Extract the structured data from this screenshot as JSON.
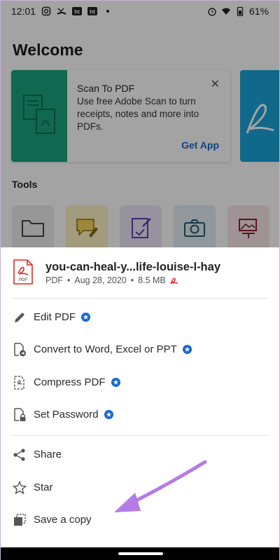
{
  "status_bar": {
    "time": "12:01",
    "battery": "61%",
    "left_icons": [
      "instagram-icon",
      "missed-call-icon",
      "ht-icon",
      "ht-icon",
      "dot-icon"
    ],
    "right_icons": [
      "alarm-icon",
      "wifi-icon",
      "battery-icon"
    ]
  },
  "home": {
    "welcome": "Welcome",
    "promo_card": {
      "title": "Scan To PDF",
      "description": "Use free Adobe Scan to turn receipts, notes and more into PDFs.",
      "cta": "Get App",
      "close_icon": "close-icon"
    },
    "tools_label": "Tools",
    "tools": [
      "folder-icon",
      "comment-icon",
      "fill-sign-icon",
      "camera-icon",
      "create-pdf-icon"
    ]
  },
  "sheet": {
    "file": {
      "name": "you-can-heal-y...life-louise-l-hay",
      "type": "PDF",
      "date": "Aug 28, 2020",
      "size": "8.5 MB",
      "icon_label": "PDF"
    },
    "premium_group": [
      {
        "label": "Edit PDF",
        "icon": "pencil-icon",
        "premium": true
      },
      {
        "label": "Convert to Word, Excel or PPT",
        "icon": "convert-icon",
        "premium": true
      },
      {
        "label": "Compress PDF",
        "icon": "compress-icon",
        "premium": true
      },
      {
        "label": "Set Password",
        "icon": "lock-file-icon",
        "premium": true
      }
    ],
    "basic_group": [
      {
        "label": "Share",
        "icon": "share-icon"
      },
      {
        "label": "Star",
        "icon": "star-icon"
      },
      {
        "label": "Save a copy",
        "icon": "copy-icon"
      }
    ]
  },
  "colors": {
    "accent_blue": "#1768d1",
    "adobe_red": "#e0291f",
    "scan_green": "#1aa37f",
    "annotation_purple": "#b57be8"
  }
}
